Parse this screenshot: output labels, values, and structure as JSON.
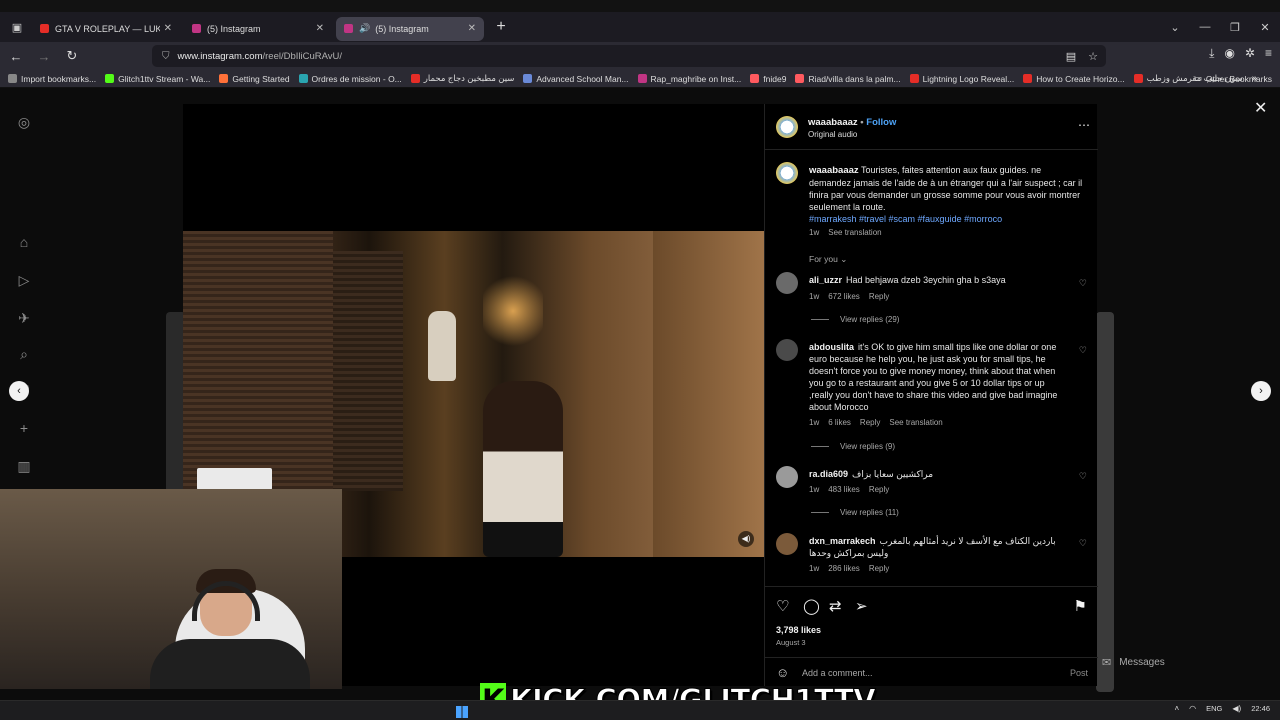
{
  "browser": {
    "tabs": [
      {
        "label": "GTA V ROLEPLAY — LUKE BAR",
        "color": "#e52d27"
      },
      {
        "label": "(5) Instagram",
        "color": "#c13584"
      },
      {
        "label": "(5) Instagram",
        "color": "#c13584",
        "active": true
      }
    ],
    "url_host": "www.instagram.com",
    "url_path": "/reel/DbIliCuRAvU/",
    "bookmarks": [
      {
        "label": "Import bookmarks...",
        "color": "#888888"
      },
      {
        "label": "Glitch1ttv Stream - Wa...",
        "color": "#53fc18"
      },
      {
        "label": "Getting Started",
        "color": "#ff7139"
      },
      {
        "label": "Ordres de mission - O...",
        "color": "#2aa5b0"
      },
      {
        "label": "سين مطبخين دجاج محمار",
        "color": "#e52d27"
      },
      {
        "label": "Advanced School Man...",
        "color": "#6a8ad8"
      },
      {
        "label": "Rap_maghribe on Inst...",
        "color": "#c13584"
      },
      {
        "label": "fnide9",
        "color": "#ff5a5f"
      },
      {
        "label": "Riad/villa dans la palm...",
        "color": "#ff5a5f"
      },
      {
        "label": "Lightning Logo Reveal...",
        "color": "#e52d27"
      },
      {
        "label": "How to Create Horizo...",
        "color": "#e52d27"
      },
      {
        "label": "سون حليب مقرمش وزطب",
        "color": "#e52d27"
      }
    ],
    "other_bookmarks": "Other Bookmarks"
  },
  "post": {
    "username": "waaabaaaz",
    "follow_label": "Follow",
    "audio": "Original audio",
    "caption_user": "waaabaaaz",
    "caption_text": "Touristes, faites attention aux faux guides. ne demandez jamais de l'aide de à un étranger qui a l'air suspect ; car il finira par vous demander un grosse somme pour vous avoir montrer seulement la route.",
    "caption_tags": "#marrakesh #travel #scam #fauxguide #morroco",
    "caption_age": "1w",
    "see_translation": "See translation",
    "sort_label": "For you",
    "likes": "3,798 likes",
    "date": "August 3",
    "add_comment_placeholder": "Add a comment...",
    "post_label": "Post"
  },
  "comments": [
    {
      "user": "ali_uzzr",
      "text": "Had behjawa dzeb 3eychin gha b s3aya",
      "age": "1w",
      "likes": "672 likes",
      "reply": "Reply",
      "view_replies": "View replies (29)"
    },
    {
      "user": "abdouslita",
      "text": "it's OK to give him small tips like one dollar or one euro because he help you, he just ask you for small tips, he doesn't force you to give money money, think about that when you go to a restaurant and you give 5 or 10 dollar tips or up ,really you don't have to share this video and give bad imagine about Morocco",
      "age": "1w",
      "likes": "6 likes",
      "reply": "Reply",
      "translation": "See translation",
      "view_replies": "View replies (9)"
    },
    {
      "user": "ra.dia609",
      "text": "مراكشيين سعايا بزاف",
      "age": "1w",
      "likes": "483 likes",
      "reply": "Reply",
      "view_replies": "View replies (11)"
    },
    {
      "user": "dxn_marrakech",
      "text": "باردين الكتاف مع الأسف لا نريد أمثالهم بالمغرب وليس بمراكش وحدها",
      "age": "1w",
      "likes": "286 likes",
      "reply": "Reply"
    }
  ],
  "page": {
    "messages_label": "Messages",
    "notification_badge": "3"
  },
  "overlay": {
    "kick_text": "KICK.COM/GLITCH1TTV",
    "kick_k": "K"
  },
  "taskbar": {
    "lang": "ENG",
    "time": "22:46"
  }
}
